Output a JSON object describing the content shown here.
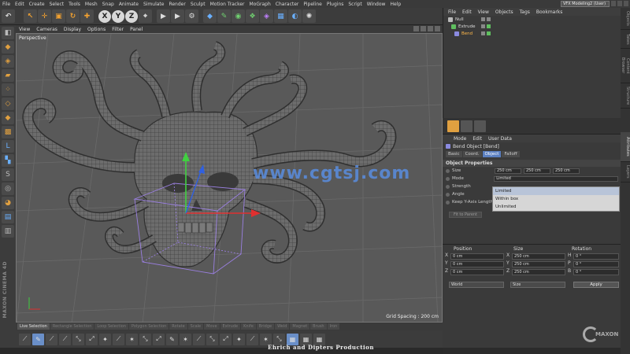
{
  "menu": [
    "File",
    "Edit",
    "Create",
    "Select",
    "Tools",
    "Mesh",
    "Snap",
    "Animate",
    "Simulate",
    "Render",
    "Sculpt",
    "Motion Tracker",
    "MoGraph",
    "Character",
    "Pipeline",
    "Plugins",
    "Script",
    "Window",
    "Help"
  ],
  "layout": "VFX Modeling2 (User)",
  "toolbar": {
    "x": "X",
    "y": "Y",
    "z": "Z"
  },
  "viewport": {
    "menu": [
      "View",
      "Cameras",
      "Display",
      "Options",
      "Filter",
      "Panel"
    ],
    "label": "Perspective",
    "grid_spacing": "Grid Spacing : 200 cm",
    "watermark": "www.cgtsj.com"
  },
  "brand": "MAXON CINEMA 4D",
  "modebar": [
    "Live Selection",
    "Rectangle Selection",
    "Loop Selection",
    "Polygon Selection",
    "Rotate",
    "Scale",
    "Move",
    "Extrude",
    "Knife",
    "Bridge",
    "Weld",
    "Magnet",
    "Brush",
    "Iron"
  ],
  "credit": "Ehrich   and   Dipters  Production",
  "object_manager": {
    "menu": [
      "File",
      "Edit",
      "View",
      "Objects",
      "Tags",
      "Bookmarks"
    ],
    "objects": [
      {
        "name": "Null",
        "color": "#bbbbbb"
      },
      {
        "name": "Extrude",
        "color": "#5fbf5f"
      },
      {
        "name": "Bend",
        "color": "#8a8ae0"
      }
    ]
  },
  "right_tabs": [
    "Objects",
    "Takes",
    "Content Browser",
    "Structure",
    "Attributes",
    "Layers"
  ],
  "attributes": {
    "menu": [
      "Mode",
      "Edit",
      "User Data"
    ],
    "title": "Bend Object [Bend]",
    "tabs": [
      "Basic",
      "Coord.",
      "Object",
      "Falloff"
    ],
    "active_tab": "Object",
    "section": "Object Properties",
    "rows": [
      {
        "label": "Size",
        "values": [
          "250 cm",
          "250 cm",
          "250 cm"
        ]
      },
      {
        "label": "Mode",
        "values": [
          "Limited"
        ]
      },
      {
        "label": "Strength",
        "values": []
      },
      {
        "label": "Angle",
        "values": []
      },
      {
        "label": "Keep Y-Axis Length",
        "values": []
      }
    ],
    "mode_options": [
      "Limited",
      "Within box",
      "Unlimited"
    ],
    "reset_button": "Fit to Parent"
  },
  "coordinates": {
    "headers": [
      "Position",
      "Size",
      "Rotation"
    ],
    "rows": [
      {
        "axis": "X",
        "pos": "0 cm",
        "size_axis": "X",
        "size": "250 cm",
        "rot_axis": "H",
        "rot": "0 °"
      },
      {
        "axis": "Y",
        "pos": "0 cm",
        "size_axis": "Y",
        "size": "250 cm",
        "rot_axis": "P",
        "rot": "0 °"
      },
      {
        "axis": "Z",
        "pos": "0 cm",
        "size_axis": "Z",
        "size": "250 cm",
        "rot_axis": "B",
        "rot": "0 °"
      }
    ],
    "space": "World",
    "size_mode": "Size",
    "apply": "Apply"
  },
  "logo_text": "MAXON"
}
